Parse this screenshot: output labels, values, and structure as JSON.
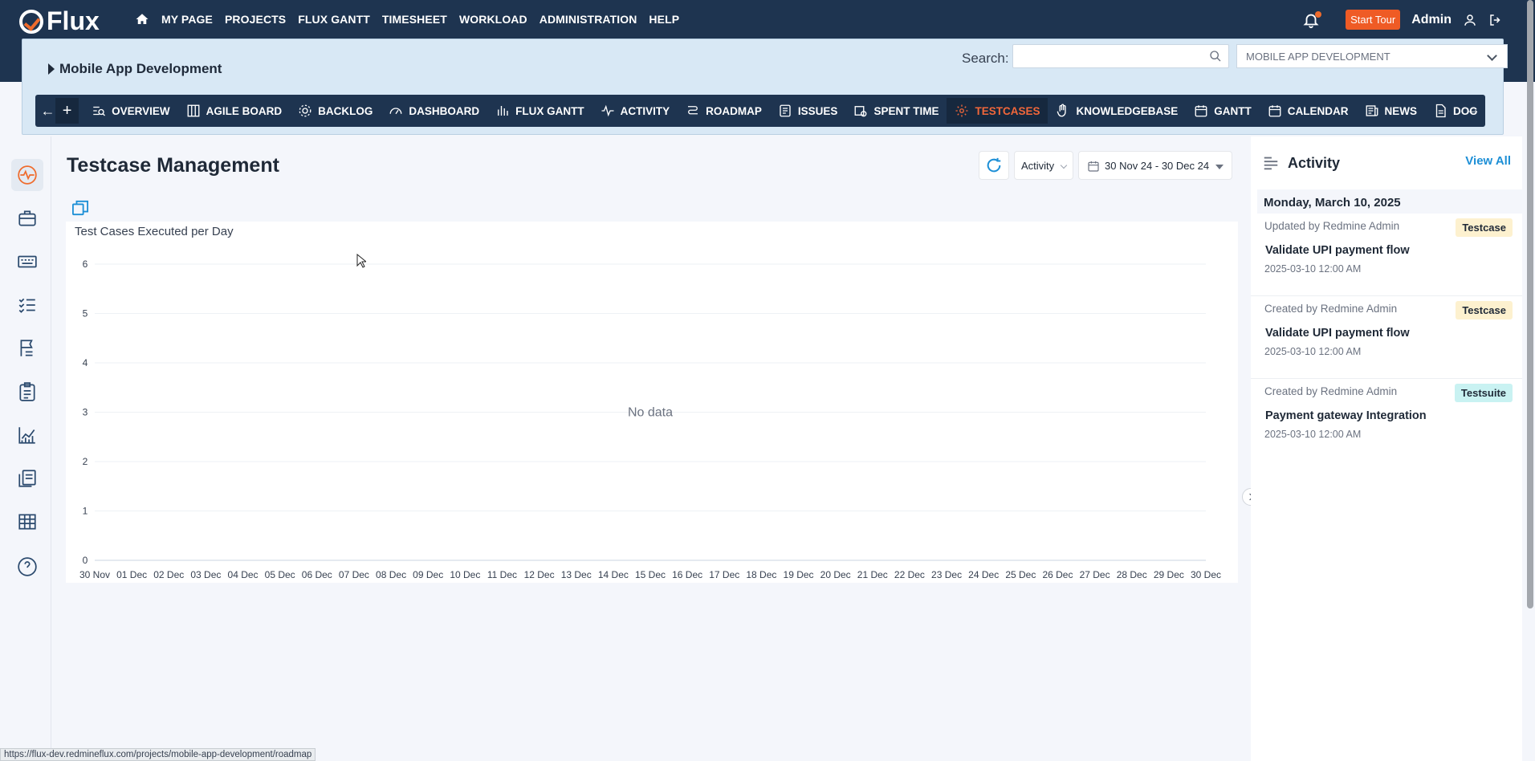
{
  "app": {
    "logo_text": "Flux",
    "nav_items": [
      "MY PAGE",
      "PROJECTS",
      "FLUX GANTT",
      "TIMESHEET",
      "WORKLOAD",
      "ADMINISTRATION",
      "HELP"
    ],
    "start_tour": "Start Tour",
    "user": "Admin"
  },
  "project": {
    "title": "Mobile App Development",
    "search_label": "Search:",
    "search_placeholder": "",
    "selected_project": "MOBILE APP DEVELOPMENT"
  },
  "modules": [
    {
      "label": "OVERVIEW",
      "icon": "overview-icon"
    },
    {
      "label": "AGILE BOARD",
      "icon": "board-icon"
    },
    {
      "label": "BACKLOG",
      "icon": "backlog-icon"
    },
    {
      "label": "DASHBOARD",
      "icon": "dashboard-icon"
    },
    {
      "label": "FLUX GANTT",
      "icon": "bars-icon"
    },
    {
      "label": "ACTIVITY",
      "icon": "pulse-icon"
    },
    {
      "label": "ROADMAP",
      "icon": "roadmap-icon"
    },
    {
      "label": "ISSUES",
      "icon": "issues-icon"
    },
    {
      "label": "SPENT TIME",
      "icon": "clock-calendar-icon"
    },
    {
      "label": "TESTCASES",
      "icon": "gear-icon",
      "active": true
    },
    {
      "label": "KNOWLEDGEBASE",
      "icon": "hand-icon"
    },
    {
      "label": "GANTT",
      "icon": "calendar-icon"
    },
    {
      "label": "CALENDAR",
      "icon": "calendar-icon"
    },
    {
      "label": "NEWS",
      "icon": "news-icon"
    },
    {
      "label": "DOC",
      "icon": "doc-icon"
    }
  ],
  "main": {
    "title": "Testcase Management",
    "activity_filter": "Activity",
    "date_range": "30 Nov 24 - 30 Dec 24"
  },
  "chart_data": {
    "type": "line",
    "title": "Test Cases Executed per Day",
    "empty_text": "No data",
    "ylim": [
      0,
      6
    ],
    "yticks": [
      0,
      1,
      2,
      3,
      4,
      5,
      6
    ],
    "categories": [
      "30 Nov",
      "01 Dec",
      "02 Dec",
      "03 Dec",
      "04 Dec",
      "05 Dec",
      "06 Dec",
      "07 Dec",
      "08 Dec",
      "09 Dec",
      "10 Dec",
      "11 Dec",
      "12 Dec",
      "13 Dec",
      "14 Dec",
      "15 Dec",
      "16 Dec",
      "17 Dec",
      "18 Dec",
      "19 Dec",
      "20 Dec",
      "21 Dec",
      "22 Dec",
      "23 Dec",
      "24 Dec",
      "25 Dec",
      "26 Dec",
      "27 Dec",
      "28 Dec",
      "29 Dec",
      "30 Dec"
    ],
    "series": [],
    "grid": true
  },
  "activity": {
    "title": "Activity",
    "view_all": "View All",
    "day": "Monday, March 10, 2025",
    "items": [
      {
        "by": "Updated by Redmine Admin",
        "tag": "Testcase",
        "tag_color": "#fdf1cf",
        "title": "Validate UPI payment flow",
        "time": "2025-03-10 12:00 AM"
      },
      {
        "by": "Created by Redmine Admin",
        "tag": "Testcase",
        "tag_color": "#fdf1cf",
        "title": "Validate UPI payment flow",
        "time": "2025-03-10 12:00 AM"
      },
      {
        "by": "Created by Redmine Admin",
        "tag": "Testsuite",
        "tag_color": "#c9f2f2",
        "title": "Payment gateway Integration",
        "time": "2025-03-10 12:00 AM"
      }
    ]
  },
  "status_url": "https://flux-dev.redmineflux.com/projects/mobile-app-development/roadmap",
  "colors": {
    "nav_bg": "#1e3450",
    "accent": "#ef6b2c",
    "link": "#1d8fd6"
  }
}
